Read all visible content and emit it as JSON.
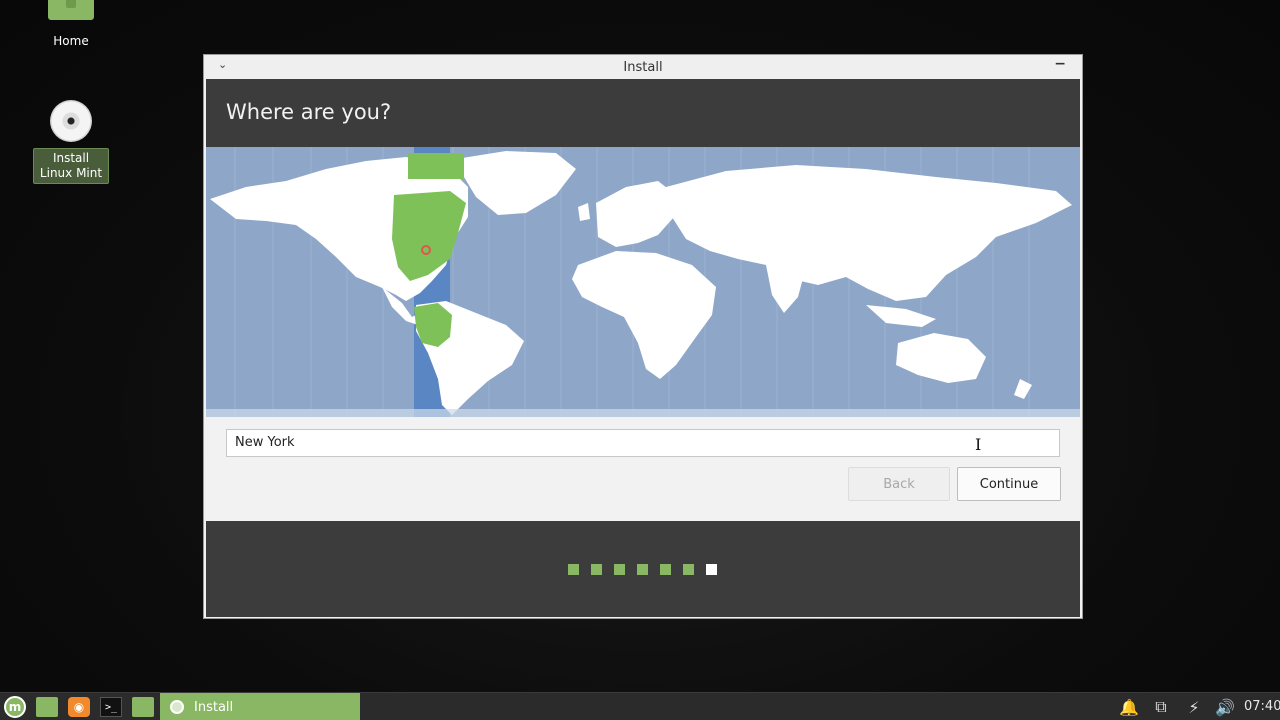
{
  "desktop": {
    "home_label": "Home",
    "install_label": "Install Linux Mint"
  },
  "window": {
    "title": "Install",
    "menu_glyph": "⌄",
    "minimize_glyph": "−",
    "heading": "Where are you?",
    "timezone_value": "New York",
    "back_label": "Back",
    "continue_label": "Continue",
    "steps_total": 7,
    "steps_current": 7
  },
  "map": {
    "selected_city": "New York",
    "highlight_color": "#7ec158",
    "ocean_color": "#8ea6c8",
    "land_color": "#ffffff",
    "band_color": "#5b86c4",
    "marker_color": "#e0584a"
  },
  "taskbar": {
    "menu_glyph": "m",
    "firefox_glyph": "◉",
    "terminal_glyph": ">_",
    "install_task_label": "Install",
    "bell_glyph": "🔔",
    "network_glyph": "⧉",
    "power_glyph": "⚡",
    "volume_glyph": "🔊",
    "clock": "07:40"
  },
  "colors": {
    "accent": "#8ab764",
    "header_bg": "#3c3c3c"
  }
}
